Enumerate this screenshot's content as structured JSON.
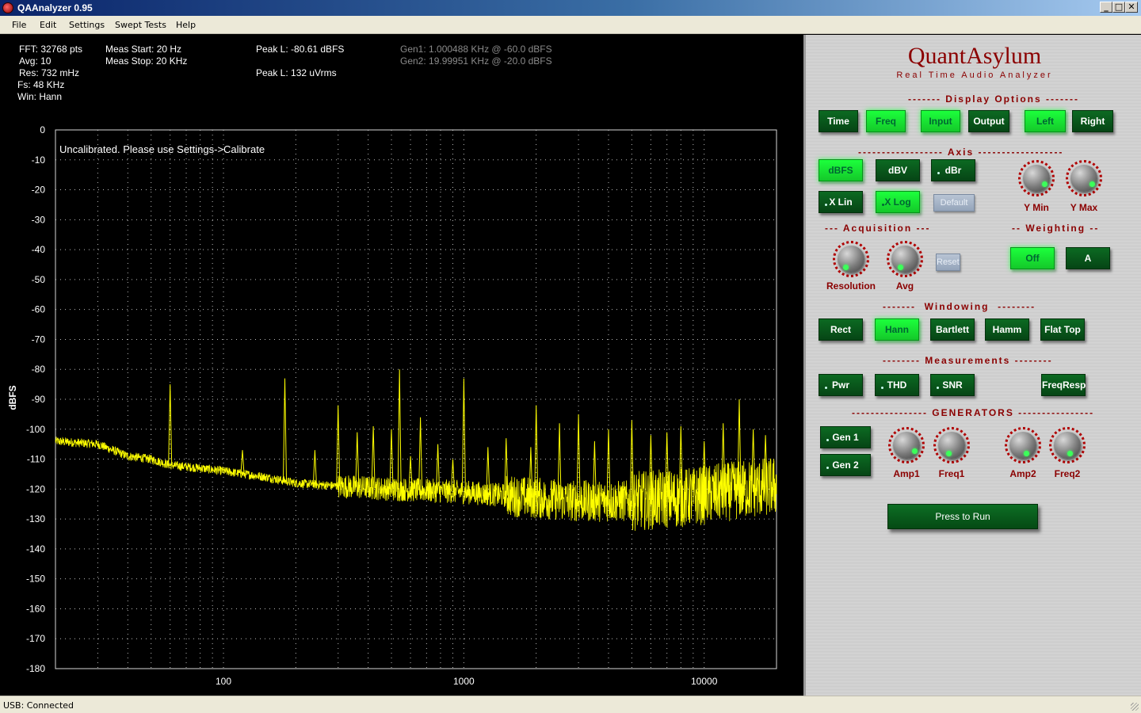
{
  "window": {
    "title": "QAAnalyzer 0.95",
    "min": "_",
    "max": "□",
    "close": "✕"
  },
  "menu": [
    "File",
    "Edit",
    "Settings",
    "Swept Tests",
    "Help"
  ],
  "info": {
    "fft": "FFT: 32768 pts",
    "avg": "Avg: 10",
    "res": "Res: 732 mHz",
    "fs": "Fs: 48 KHz",
    "win": "Win: Hann",
    "meas_start": "Meas Start: 20 Hz",
    "meas_stop": "Meas Stop: 20 KHz",
    "peak_dbfs": "Peak L: -80.61 dBFS",
    "peak_uv": "Peak L: 132 uVrms",
    "gen1": "Gen1: 1.000488 KHz @ -60.0 dBFS",
    "gen2": "Gen2: 19.99951 KHz @ -20.0 dBFS"
  },
  "chart_data": {
    "type": "line",
    "ylabel": "dBFS",
    "annotation": "Uncalibrated. Please use Settings->Calibrate",
    "x_scale": "log",
    "xlim": [
      20,
      20000
    ],
    "ylim": [
      -180,
      0
    ],
    "x_ticks": [
      100,
      1000,
      10000
    ],
    "y_ticks": [
      0,
      -10,
      -20,
      -30,
      -40,
      -50,
      -60,
      -70,
      -80,
      -90,
      -100,
      -110,
      -120,
      -130,
      -140,
      -150,
      -160,
      -170,
      -180
    ],
    "grid": true,
    "trace_color": "#ffff00",
    "series": [
      {
        "noise_floor": [
          [
            20,
            -104
          ],
          [
            30,
            -105
          ],
          [
            40,
            -109
          ],
          [
            50,
            -110
          ],
          [
            60,
            -112
          ],
          [
            80,
            -113
          ],
          [
            100,
            -114
          ],
          [
            150,
            -116
          ],
          [
            200,
            -118
          ],
          [
            300,
            -119
          ],
          [
            500,
            -120
          ],
          [
            1000,
            -121
          ],
          [
            2000,
            -123
          ],
          [
            3000,
            -124
          ],
          [
            5000,
            -124
          ],
          [
            8000,
            -123
          ],
          [
            10000,
            -122
          ],
          [
            15000,
            -120
          ],
          [
            20000,
            -119
          ]
        ],
        "peaks": [
          [
            60,
            -85
          ],
          [
            120,
            -107
          ],
          [
            180,
            -83
          ],
          [
            240,
            -107
          ],
          [
            300,
            -92
          ],
          [
            360,
            -101
          ],
          [
            420,
            -99
          ],
          [
            500,
            -100
          ],
          [
            540,
            -80
          ],
          [
            600,
            -109
          ],
          [
            660,
            -96
          ],
          [
            780,
            -105
          ],
          [
            900,
            -110
          ],
          [
            1000,
            -83
          ],
          [
            1260,
            -106
          ],
          [
            1500,
            -103
          ],
          [
            1900,
            -106
          ],
          [
            2000,
            -92
          ],
          [
            2500,
            -98
          ],
          [
            3000,
            -95
          ],
          [
            3500,
            -104
          ],
          [
            4000,
            -100
          ],
          [
            5000,
            -97
          ],
          [
            6000,
            -102
          ],
          [
            7000,
            -101
          ],
          [
            8000,
            -99
          ],
          [
            10000,
            -104
          ],
          [
            12000,
            -98
          ],
          [
            14000,
            -90
          ],
          [
            16000,
            -100
          ],
          [
            18000,
            -102
          ]
        ]
      }
    ]
  },
  "panel": {
    "brand": "QuantAsylum",
    "tagline": "Real Time Audio Analyzer",
    "sections": {
      "display": "------- Display Options -------",
      "axis": "------------------ Axis ------------------",
      "acq": "--- Acquisition ---",
      "weighting": "-- Weighting --",
      "windowing": "-------  Windowing  --------",
      "measurements": "-------- Measurements --------",
      "generators": "---------------- GENERATORS ----------------"
    },
    "display_buttons": [
      "Time",
      "Freq",
      "Input",
      "Output",
      "Left",
      "Right"
    ],
    "axis_buttons": [
      "dBFS",
      "dBV",
      "dBr",
      "X Lin",
      "X Log",
      "Default"
    ],
    "axis_knobs": [
      "Y Min",
      "Y Max"
    ],
    "acq_knobs": [
      "Resolution",
      "Avg"
    ],
    "acq_reset": "Reset",
    "weighting_buttons": [
      "Off",
      "A"
    ],
    "window_buttons": [
      "Rect",
      "Hann",
      "Bartlett",
      "Hamm",
      "Flat Top"
    ],
    "measure_buttons": [
      "Pwr",
      "THD",
      "SNR",
      "FreqResp"
    ],
    "gen_buttons": [
      "Gen 1",
      "Gen 2"
    ],
    "gen_knobs": [
      "Amp1",
      "Freq1",
      "Amp2",
      "Freq2"
    ],
    "run": "Press to Run",
    "accent": "#8b0000",
    "on_color": "#1cff3c"
  },
  "status": "USB: Connected"
}
